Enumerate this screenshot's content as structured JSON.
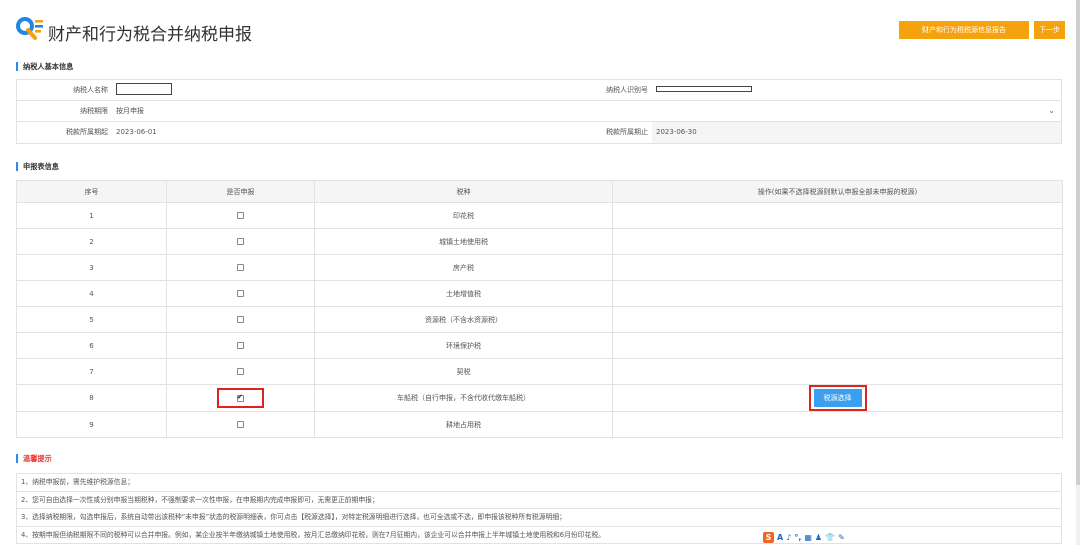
{
  "header": {
    "title": "财产和行为税合并纳税申报",
    "report_button": "财产和行为税税源信息报告",
    "next_button": "下一步"
  },
  "basic": {
    "section_title": "纳税人基本信息",
    "name_label": "纳税人名称",
    "id_label": "纳税人识别号",
    "period_label": "纳税期限",
    "period_value": "按月申报",
    "start_label": "税款所属期起",
    "start_value": "2023-06-01",
    "end_label": "税款所属期止",
    "end_value": "2023-06-30"
  },
  "declaration": {
    "section_title": "申报表信息",
    "headers": [
      "序号",
      "是否申报",
      "税种",
      "操作(如果不选择税源则默认申报全部未申报的税源)"
    ],
    "rows": [
      {
        "no": "1",
        "tax": "印花税",
        "checked": false
      },
      {
        "no": "2",
        "tax": "城镇土地使用税",
        "checked": false
      },
      {
        "no": "3",
        "tax": "房产税",
        "checked": false
      },
      {
        "no": "4",
        "tax": "土地增值税",
        "checked": false
      },
      {
        "no": "5",
        "tax": "资源税（不含水资源税）",
        "checked": false
      },
      {
        "no": "6",
        "tax": "环境保护税",
        "checked": false
      },
      {
        "no": "7",
        "tax": "契税",
        "checked": false
      },
      {
        "no": "8",
        "tax": "车船税（自行申报，不含代收代缴车船税）",
        "checked": true
      },
      {
        "no": "9",
        "tax": "耕地占用税",
        "checked": false
      }
    ],
    "source_button": "税源选择"
  },
  "tips": {
    "section_title": "温馨提示",
    "lines": [
      "1、纳税申报前，需先维护税源信息；",
      "2、您可自由选择一次性或分别申报当期税种，不强制要求一次性申报，在申报期内完成申报即可，无需更正前期申报；",
      "3、选择纳税期限，勾选申报后，系统自动带出该税种“未申报”状态的税源明细表，你可点击【税源选择】，对特定税源明细进行选择，也可全选或不选，即申报该税种所有税源明细；",
      "4、按期申报但纳税期限不同的税种可以合并申报。例如，某企业按半年缴纳城镇土地使用税，按月汇总缴纳印花税，则在7月征期内，该企业可以合并申报上半年城镇土地使用税和6月份印花税。"
    ]
  },
  "ime": {
    "logo": "S",
    "items": [
      "A",
      "♪",
      "°,",
      "▦",
      "♟",
      "👕",
      "✎"
    ]
  },
  "colors": {
    "accent_orange": "#f5a20f",
    "accent_blue": "#3b9ff0",
    "highlight_red": "#d9251d"
  }
}
